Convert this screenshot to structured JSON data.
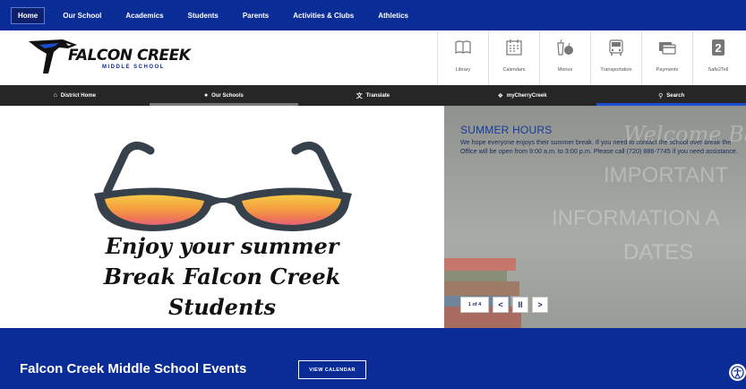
{
  "topnav": {
    "items": [
      "Home",
      "Our School",
      "Academics",
      "Students",
      "Parents",
      "Activities & Clubs",
      "Athletics"
    ]
  },
  "header": {
    "logo_name": "FALCON CREEK",
    "logo_sub": "MIDDLE SCHOOL"
  },
  "quick_links": [
    {
      "label": "Library",
      "icon": "book-icon"
    },
    {
      "label": "Calendars",
      "icon": "calendar-icon"
    },
    {
      "label": "Menus",
      "icon": "menu-apple-icon"
    },
    {
      "label": "Transportation",
      "icon": "bus-icon"
    },
    {
      "label": "Payments",
      "icon": "payment-card-icon"
    },
    {
      "label": "Safe2Tell",
      "icon": "safe2tell-icon"
    }
  ],
  "utility_bar": [
    {
      "label": "District Home",
      "icon": "home-icon"
    },
    {
      "label": "Our Schools",
      "icon": "location-pin-icon"
    },
    {
      "label": "Translate",
      "icon": "translate-icon"
    },
    {
      "label": "myCherryCreek",
      "icon": "cherry-creek-icon"
    },
    {
      "label": "Search",
      "icon": "search-icon"
    }
  ],
  "hero": {
    "script_lines": [
      "Enjoy your summer",
      "Break Falcon Creek",
      "Students"
    ],
    "bg_words": [
      "Welcome Bac",
      "IMPORTANT",
      "INFORMATION A",
      "DATES"
    ],
    "slide_title": "SUMMER HOURS",
    "slide_body": "We hope everyone enjoys their summer break. If you need to contact the school over break the Office will be open from 9:00 a.m. to 3:00 p.m. Please call (720) 886-7745 if you need assistance.",
    "slide_counter": "1 of 4",
    "prev_glyph": "<",
    "pause_glyph": "II",
    "next_glyph": ">"
  },
  "events": {
    "title": "Falcon Creek Middle School Events",
    "button": "VIEW CALENDAR"
  },
  "colors": {
    "nav_blue": "#0a2c96",
    "utility_bar": "#262626",
    "slide_title": "#163a9c"
  }
}
